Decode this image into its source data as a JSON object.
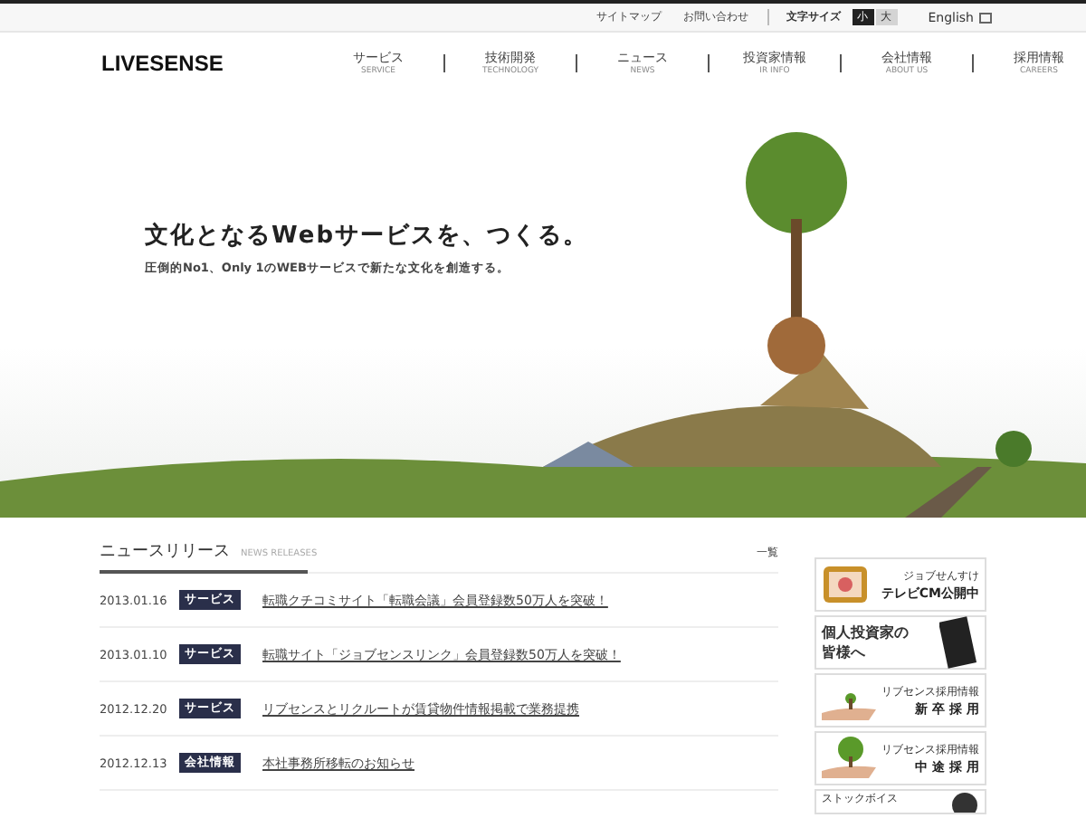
{
  "top_links": [
    "サイトマップ",
    "お問い合わせ"
  ],
  "font_size": {
    "label": "文字サイズ",
    "options": [
      {
        "label": "小",
        "selected": true
      },
      {
        "label": "大",
        "selected": false
      }
    ]
  },
  "language_link": "English",
  "logo": "LIVESENSE",
  "nav": [
    {
      "label": "サービス",
      "sub": "SERVICE"
    },
    {
      "label": "技術開発",
      "sub": "TECHNOLOGY"
    },
    {
      "label": "ニュース",
      "sub": "NEWS"
    },
    {
      "label": "投資家情報",
      "sub": "IR INFO"
    },
    {
      "label": "会社情報",
      "sub": "ABOUT US"
    },
    {
      "label": "採用情報",
      "sub": "CAREERS"
    }
  ],
  "hero": {
    "headline": "文化となるWebサービスを、つくる。",
    "subline": "圧倒的No1、Only 1のWEBサービスで新たな文化を創造する。"
  },
  "news": {
    "title": "ニュースリリース",
    "subtitle": "NEWS RELEASES",
    "more_link": "一覧",
    "items": [
      {
        "date": "2013.01.16",
        "tag": "サービス",
        "text": "転職クチコミサイト「転職会議」会員登録数50万人を突破！"
      },
      {
        "date": "2013.01.10",
        "tag": "サービス",
        "text": "転職サイト「ジョブセンスリンク」会員登録数50万人を突破！"
      },
      {
        "date": "2012.12.20",
        "tag": "サービス",
        "text": "リブセンスとリクルートが賃貸物件情報掲載で業務提携"
      },
      {
        "date": "2012.12.13",
        "tag": "会社情報",
        "text": "本社事務所移転のお知らせ"
      }
    ]
  },
  "banners": [
    {
      "kind": "tv",
      "small": "ジョブせんすけ",
      "large": "テレビCM公開中"
    },
    {
      "kind": "investor",
      "large": "個人投資家の皆様へ"
    },
    {
      "kind": "sprout",
      "small": "リブセンス採用情報",
      "large": "新 卒 採 用"
    },
    {
      "kind": "tree",
      "small": "リブセンス採用情報",
      "large": "中 途 採 用"
    },
    {
      "kind": "person",
      "small": "ストックボイス"
    }
  ]
}
